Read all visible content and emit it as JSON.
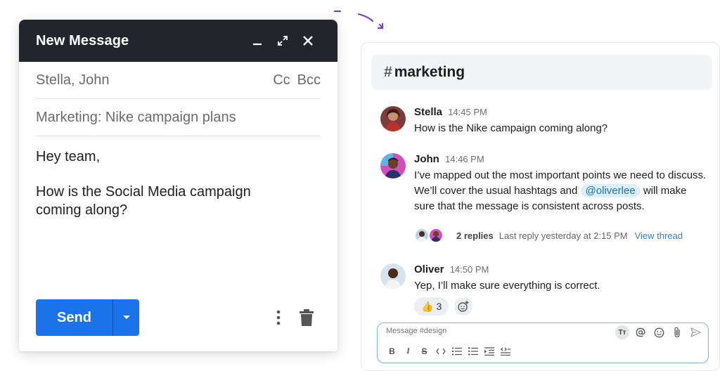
{
  "compose": {
    "title": "New Message",
    "to": "Stella, John",
    "cc_label": "Cc",
    "bcc_label": "Bcc",
    "subject": "Marketing: Nike campaign plans",
    "body": [
      "Hey team,",
      "How is the Social Media campaign coming along?"
    ],
    "send_label": "Send",
    "send_color": "#1a73e8",
    "header_color": "#20262b"
  },
  "chat": {
    "channel": "marketing",
    "channel_prefix": "#",
    "messages": [
      {
        "author": "Stella",
        "time": "14:45 PM",
        "text": "How is the Nike campaign coming along?"
      },
      {
        "author": "John",
        "time": "14:46 PM",
        "text_before": "I’ve mapped out the most important points we need to discuss. We’ll cover the usual hashtags and",
        "mention": "@oliverlee",
        "text_after": "will make sure that the message is consistent across posts."
      },
      {
        "author": "Oliver",
        "time": "14:50 PM",
        "text": "Yep, I’ll make sure everything is correct."
      }
    ],
    "thread": {
      "replies": "2 replies",
      "last_reply": "Last reply yesterday at 2:15 PM",
      "view_thread": "View thread"
    },
    "reaction": {
      "emoji": "👍",
      "count": "3"
    },
    "composer": {
      "placeholder": "Message #design"
    },
    "mention_color": "#dcefff",
    "link_color": "#2b86c5"
  },
  "icons": [
    "minimize-icon",
    "expand-icon",
    "close-icon",
    "chevron-down-icon",
    "more-vertical-icon",
    "trash-icon",
    "add-reaction-icon",
    "text-format-icon",
    "at-icon",
    "emoji-icon",
    "attach-icon",
    "send-icon",
    "bold-icon",
    "italic-icon",
    "strikethrough-icon",
    "code-icon",
    "ordered-list-icon",
    "bullet-list-icon",
    "indent-icon",
    "code-block-icon"
  ]
}
